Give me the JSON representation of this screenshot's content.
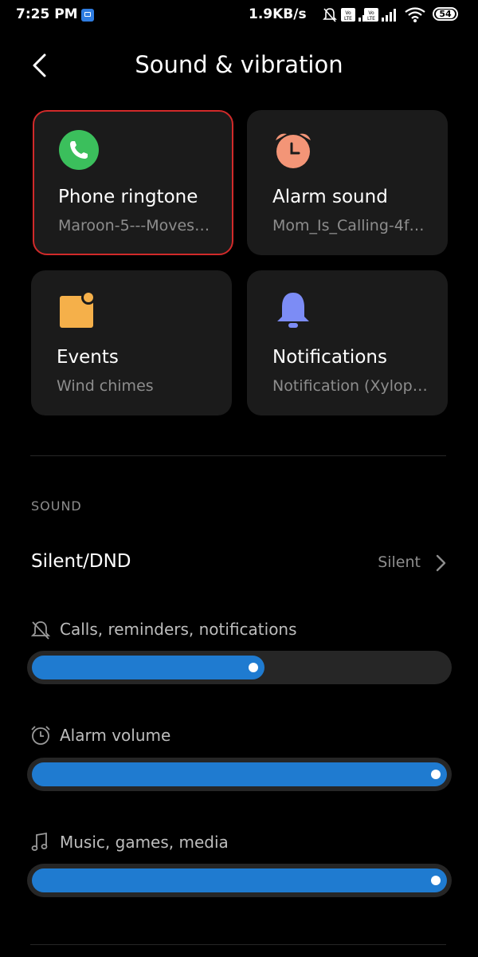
{
  "status_bar": {
    "time": "7:25 PM",
    "rate": "1.9KB/s",
    "battery": "54",
    "icons": [
      "app-badge-icon",
      "mute-bell-icon",
      "volte-icon",
      "signal-icon",
      "volte-icon",
      "signal-icon",
      "wifi-icon",
      "battery-icon"
    ]
  },
  "header": {
    "title": "Sound & vibration",
    "back_icon": "chevron-left-icon"
  },
  "tiles": [
    {
      "label": "Phone ringtone",
      "sub": "Maroon-5---Moves…",
      "icon": "phone-icon",
      "color": "#3bbf5c"
    },
    {
      "label": "Alarm sound",
      "sub": "Mom_Is_Calling-4f…",
      "icon": "alarm-clock-icon",
      "color": "#f39577"
    },
    {
      "label": "Events",
      "sub": "Wind chimes",
      "icon": "calendar-event-icon",
      "color": "#f5b04a"
    },
    {
      "label": "Notifications",
      "sub": "Notification (Xylop…",
      "icon": "bell-icon",
      "color": "#7c8cf5"
    }
  ],
  "sound": {
    "section_label": "SOUND",
    "silent_label": "Silent/DND",
    "silent_value": "Silent",
    "volumes": [
      {
        "label": "Calls, reminders, notifications",
        "icon": "mute-bell-icon",
        "level": 0.56
      },
      {
        "label": "Alarm volume",
        "icon": "alarm-clock-icon",
        "level": 1.0
      },
      {
        "label": "Music, games, media",
        "icon": "music-note-icon",
        "level": 1.0
      }
    ]
  },
  "colors": {
    "accent": "#1f7bd0",
    "selection": "#d12a2a",
    "tile_bg": "#1b1b1b"
  }
}
